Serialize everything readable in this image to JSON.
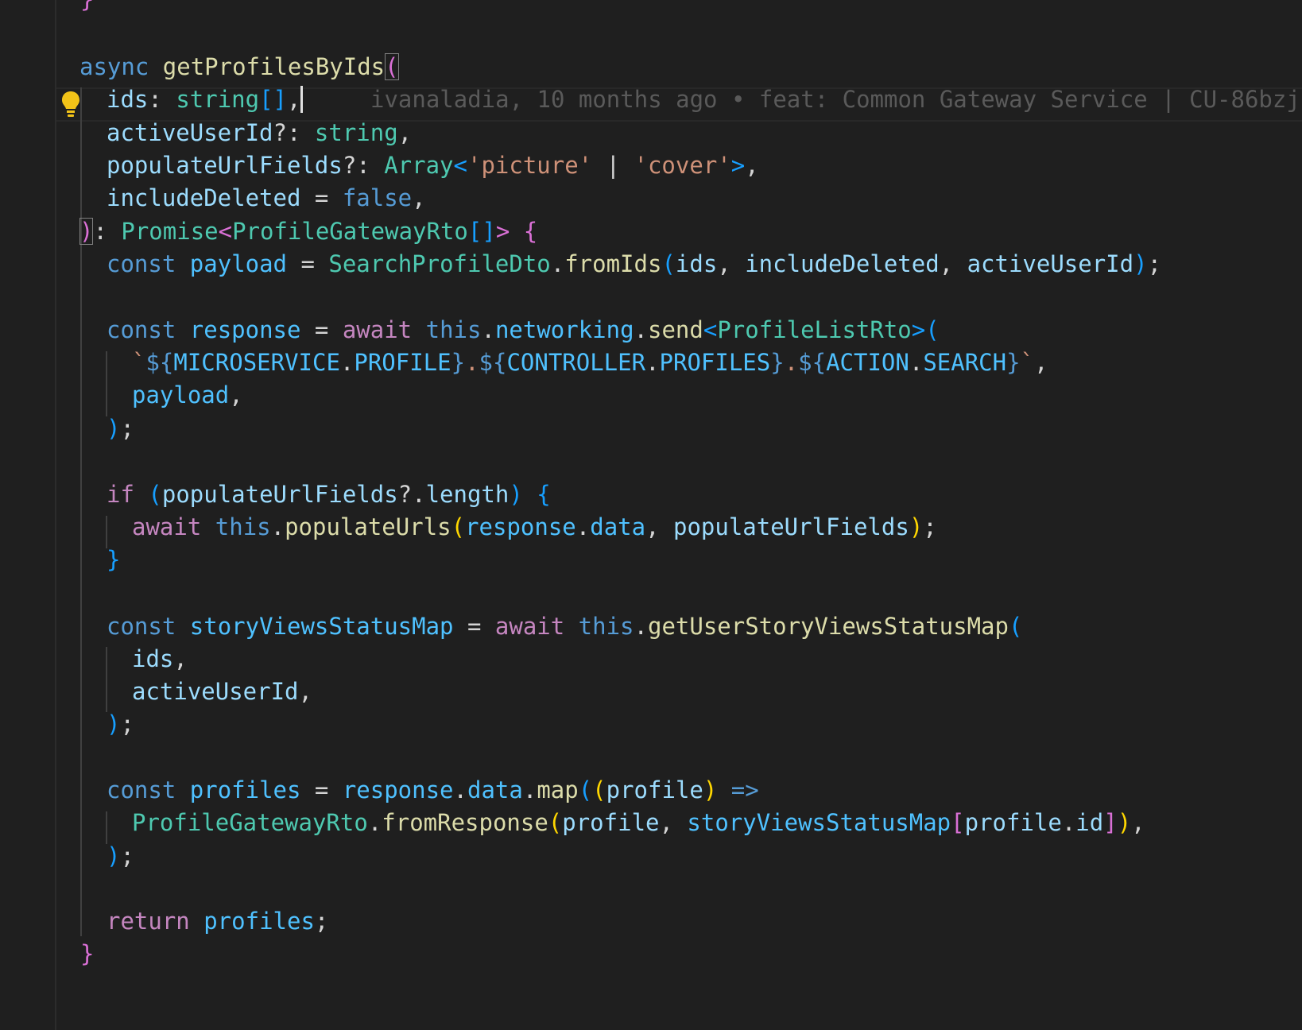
{
  "editor": {
    "blame": "ivanaladia, 10 months ago • feat: Common Gateway Service | CU-86bzj",
    "lines": {
      "l0": {
        "brace": "}"
      },
      "l1": {
        "async": "async",
        "fn": "getProfilesByIds",
        "paren": "("
      },
      "l2": {
        "ids": "ids",
        "colon": ": ",
        "type": "string",
        "arr": "[]",
        "comma": ","
      },
      "l3": {
        "name": "activeUserId",
        "rest": "?: ",
        "type": "string",
        "comma": ","
      },
      "l4": {
        "name": "populateUrlFields",
        "rest": "?: ",
        "type": "Array",
        "lt": "<",
        "s1": "'picture'",
        "bar": " | ",
        "s2": "'cover'",
        "gt": ">",
        "comma": ","
      },
      "l5": {
        "name": "includeDeleted",
        "eq": " = ",
        "val": "false",
        "comma": ","
      },
      "l6": {
        "paren": ")",
        "colon": ": ",
        "type": "Promise",
        "lt": "<",
        "type2": "ProfileGatewayRto",
        "arr": "[]",
        "gt": ">",
        "brace": " {"
      },
      "l7": {
        "kw": "const",
        "name": " payload",
        "eq": " = ",
        "cls": "SearchProfileDto",
        "dot": ".",
        "fn": "fromIds",
        "p": "(",
        "a1": "ids",
        "c1": ", ",
        "a2": "includeDeleted",
        "c2": ", ",
        "a3": "activeUserId",
        "pe": ")",
        "semi": ";"
      },
      "l8": {
        "kw": "const",
        "name": " response",
        "eq": " = ",
        "aw": "await",
        "th": " this",
        "dot": ".",
        "prop": "networking",
        "dot2": ".",
        "fn": "send",
        "lt": "<",
        "type": "ProfileListRto",
        "gt": ">",
        "p": "("
      },
      "l9": {
        "bt": "`",
        "d1": "${",
        "c1": "MICROSERVICE",
        "dt1": ".",
        "c2": "PROFILE",
        "e1": "}",
        "dt2": ".",
        "d2": "${",
        "c3": "CONTROLLER",
        "dt3": ".",
        "c4": "PROFILES",
        "e2": "}",
        "dt4": ".",
        "d3": "${",
        "c5": "ACTION",
        "dt5": ".",
        "c6": "SEARCH",
        "e3": "}",
        "bt2": "`",
        "comma": ","
      },
      "l10": {
        "name": "payload",
        "comma": ","
      },
      "l11": {
        "p": ")",
        "semi": ";"
      },
      "l12": {
        "kw": "if",
        "sp": " ",
        "p": "(",
        "name": "populateUrlFields",
        "opt": "?.",
        "prop": "length",
        "pe": ")",
        "brace": " {"
      },
      "l13": {
        "aw": "await",
        "th": " this",
        "dot": ".",
        "fn": "populateUrls",
        "p": "(",
        "a1": "response",
        "dot2": ".",
        "a2": "data",
        "c1": ", ",
        "a3": "populateUrlFields",
        "pe": ")",
        "semi": ";"
      },
      "l14": {
        "brace": "}"
      },
      "l15": {
        "kw": "const",
        "name": " storyViewsStatusMap",
        "eq": " = ",
        "aw": "await",
        "th": " this",
        "dot": ".",
        "fn": "getUserStoryViewsStatusMap",
        "p": "("
      },
      "l16": {
        "name": "ids",
        "comma": ","
      },
      "l17": {
        "name": "activeUserId",
        "comma": ","
      },
      "l18": {
        "p": ")",
        "semi": ";"
      },
      "l19": {
        "kw": "const",
        "name": " profiles",
        "eq": " = ",
        "obj": "response",
        "dot": ".",
        "prop": "data",
        "dot2": ".",
        "fn": "map",
        "p": "(",
        "p2": "(",
        "param": "profile",
        "p2e": ")",
        "arrow": " =>"
      },
      "l20": {
        "cls": "ProfileGatewayRto",
        "dot": ".",
        "fn": "fromResponse",
        "p": "(",
        "a1": "profile",
        "c1": ", ",
        "a2": "storyViewsStatusMap",
        "b": "[",
        "a3": "profile",
        "dot2": ".",
        "a4": "id",
        "be": "]",
        "pe": ")",
        "comma": ","
      },
      "l21": {
        "p": ")",
        "semi": ";"
      },
      "l22": {
        "kw": "return",
        "name": " profiles",
        "semi": ";"
      },
      "l23": {
        "brace": "}"
      }
    }
  }
}
